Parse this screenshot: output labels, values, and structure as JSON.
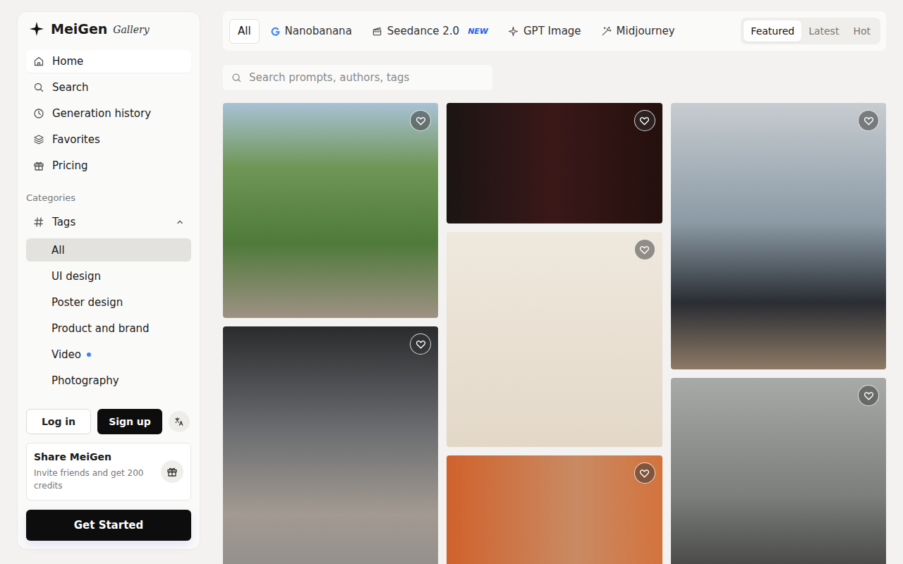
{
  "brand": {
    "name": "MeiGen",
    "subtitle": "Gallery"
  },
  "nav": [
    {
      "label": "Home",
      "selected": true
    },
    {
      "label": "Search",
      "selected": false
    },
    {
      "label": "Generation history",
      "selected": false
    },
    {
      "label": "Favorites",
      "selected": false
    },
    {
      "label": "Pricing",
      "selected": false
    }
  ],
  "categories": {
    "label": "Categories",
    "group": {
      "label": "Tags",
      "expanded": true,
      "items": [
        {
          "label": "All",
          "selected": true,
          "dot": false
        },
        {
          "label": "UI design",
          "selected": false,
          "dot": false
        },
        {
          "label": "Poster design",
          "selected": false,
          "dot": false
        },
        {
          "label": "Product and brand",
          "selected": false,
          "dot": false
        },
        {
          "label": "Video",
          "selected": false,
          "dot": true
        },
        {
          "label": "Photography",
          "selected": false,
          "dot": false
        }
      ]
    }
  },
  "auth": {
    "login": "Log in",
    "signup": "Sign up"
  },
  "share": {
    "title": "Share MeiGen",
    "text": "Invite friends and get 200 credits"
  },
  "cta": "Get Started",
  "models": [
    {
      "label": "All",
      "selected": true,
      "badge": ""
    },
    {
      "label": "Nanobanana",
      "selected": false,
      "badge": ""
    },
    {
      "label": "Seedance 2.0",
      "selected": false,
      "badge": "NEW"
    },
    {
      "label": "GPT Image",
      "selected": false,
      "badge": ""
    },
    {
      "label": "Midjourney",
      "selected": false,
      "badge": ""
    }
  ],
  "sort": [
    {
      "label": "Featured",
      "selected": true
    },
    {
      "label": "Latest",
      "selected": false
    },
    {
      "label": "Hot",
      "selected": false
    }
  ],
  "search": {
    "placeholder": "Search prompts, authors, tags"
  },
  "gallery": {
    "columns": [
      [
        {
          "favorited": false
        },
        {
          "favorited": false
        }
      ],
      [
        {
          "favorited": false
        },
        {
          "favorited": false
        },
        {
          "favorited": false
        }
      ],
      [
        {
          "favorited": false
        },
        {
          "favorited": false
        }
      ]
    ]
  }
}
